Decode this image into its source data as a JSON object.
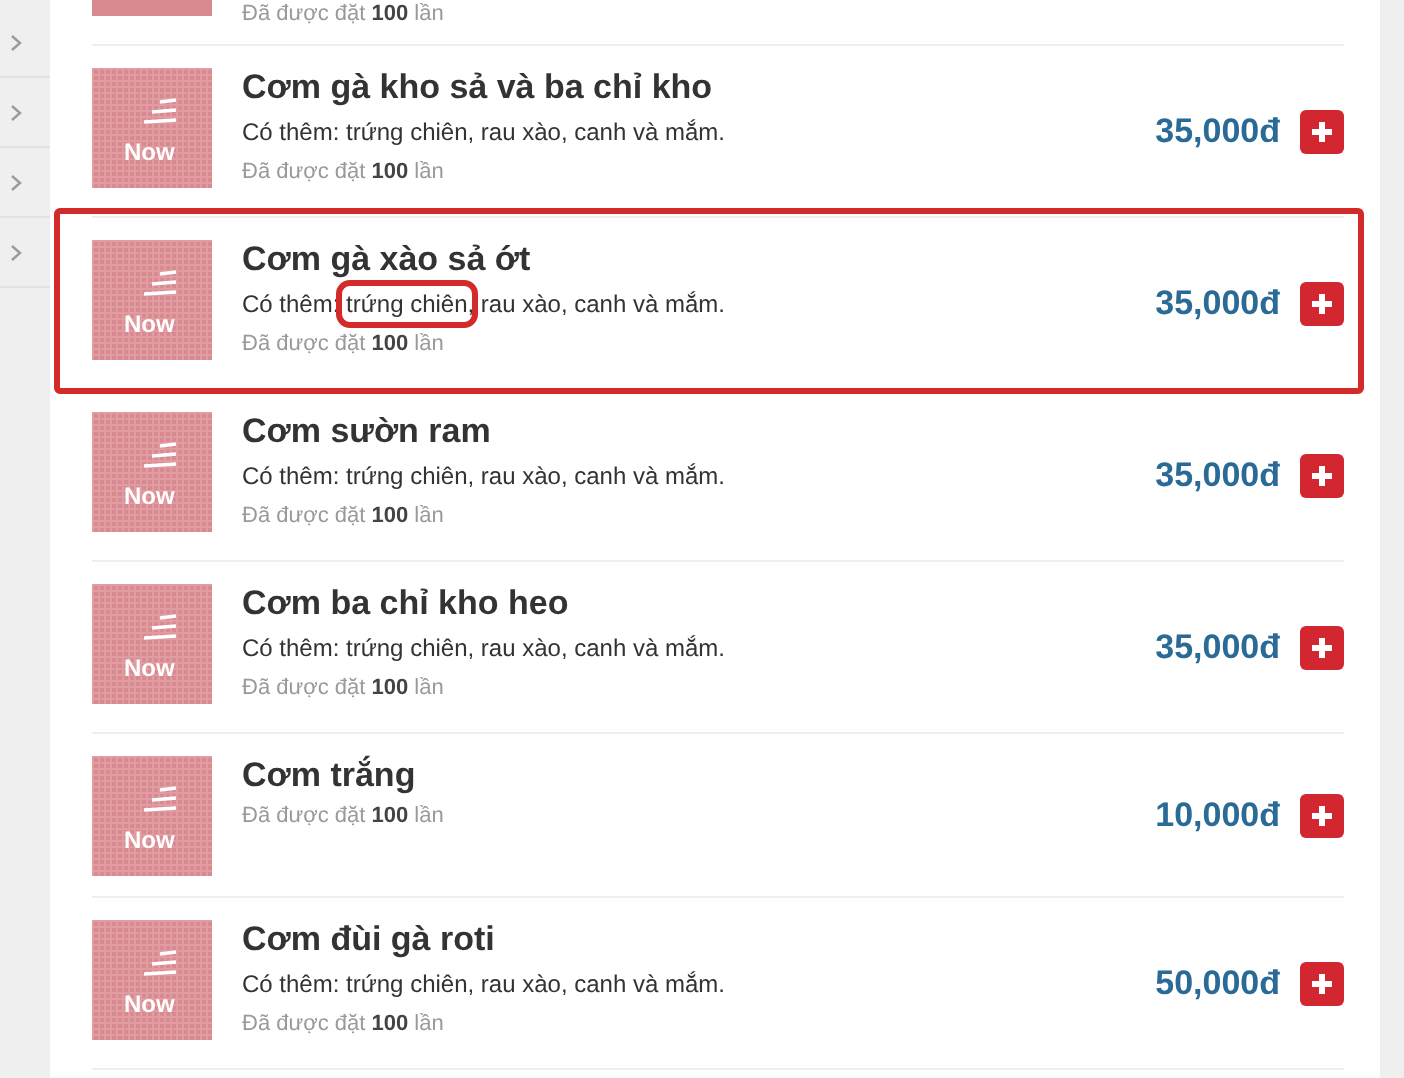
{
  "top_partial": {
    "ordered_prefix": "Đã được đặt",
    "ordered_count": "100",
    "ordered_suffix": "lần"
  },
  "items": [
    {
      "name": "Cơm gà kho sả và ba chỉ kho",
      "badge": "Now",
      "description": [
        {
          "text": "Có thêm: trứng chiên, rau xào, canh và mắm."
        }
      ],
      "ordered_prefix": "Đã được đặt",
      "ordered_count": "100",
      "ordered_suffix": "lần",
      "price": "35,000đ",
      "highlighted": false
    },
    {
      "name": "Cơm gà xào sả ớt",
      "badge": "Now",
      "description": [
        {
          "text": "Có thêm: "
        },
        {
          "text": "trứng chiên",
          "boxed": true
        },
        {
          "text": ", rau xào, canh và mắm."
        }
      ],
      "ordered_prefix": "Đã được đặt",
      "ordered_count": "100",
      "ordered_suffix": "lần",
      "price": "35,000đ",
      "highlighted": true
    },
    {
      "name": "Cơm sườn ram",
      "badge": "Now",
      "description": [
        {
          "text": "Có thêm: trứng chiên, rau xào, canh và mắm."
        }
      ],
      "ordered_prefix": "Đã được đặt",
      "ordered_count": "100",
      "ordered_suffix": "lần",
      "price": "35,000đ",
      "highlighted": false
    },
    {
      "name": "Cơm ba chỉ kho heo",
      "badge": "Now",
      "description": [
        {
          "text": "Có thêm: trứng chiên, rau xào, canh và mắm."
        }
      ],
      "ordered_prefix": "Đã được đặt",
      "ordered_count": "100",
      "ordered_suffix": "lần",
      "price": "35,000đ",
      "highlighted": false
    },
    {
      "name": "Cơm trắng",
      "badge": "Now",
      "ordered_prefix": "Đã được đặt",
      "ordered_count": "100",
      "ordered_suffix": "lần",
      "price": "10,000đ",
      "highlighted": false
    },
    {
      "name": "Cơm đùi gà roti",
      "badge": "Now",
      "description": [
        {
          "text": "Có thêm: trứng chiên, rau xào, canh và mắm."
        }
      ],
      "ordered_prefix": "Đã được đặt",
      "ordered_count": "100",
      "ordered_suffix": "lần",
      "price": "50,000đ",
      "highlighted": false
    }
  ]
}
